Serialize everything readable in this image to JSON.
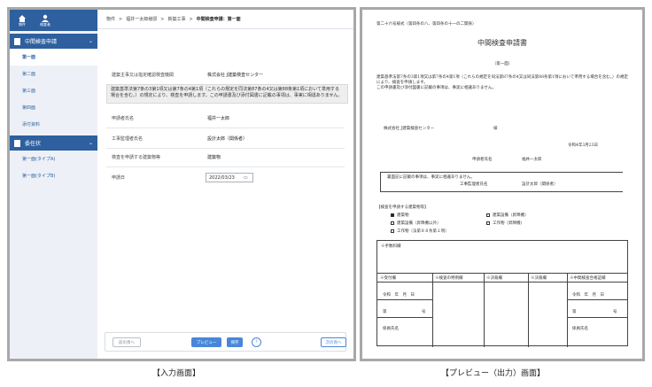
{
  "sidebar": {
    "nav": [
      {
        "label": "物件"
      },
      {
        "label": "検査者"
      }
    ],
    "group1": {
      "label": "中間検査申請"
    },
    "items": [
      {
        "label": "第一面",
        "active": true
      },
      {
        "label": "第二面"
      },
      {
        "label": "第三面"
      },
      {
        "label": "第四面"
      },
      {
        "label": "添付資料"
      }
    ],
    "group2": {
      "label": "委任状"
    },
    "items2": [
      {
        "label": "第一面(タイプA)"
      },
      {
        "label": "第一面(タイプB)"
      }
    ]
  },
  "breadcrumb": {
    "items": [
      "物件",
      "福井一太郎様邸",
      "新築工事"
    ],
    "current": "中間検査申請：第一面",
    "separator": ">"
  },
  "form": {
    "addressee_label": "建築主事又は指定確認検査機関",
    "addressee_value": "株式会社 J建築検査センター",
    "notice": "建築基準法第7条の3第1項又は第7条の4第1項（これらの規定を同法第87条の4又は第88条第1項において準用する場合を含む。）の規定により、検査を申請します。この申請書及び添付図書に記載の事項は、事実に相違ありません。",
    "fields": [
      {
        "label": "申請者氏名",
        "value": "福井一太郎"
      },
      {
        "label": "工事監理者氏名",
        "value": "設計太郎（関係者）"
      },
      {
        "label": "検査を申請する建築物等",
        "value": "建築物"
      }
    ],
    "date_label": "申請日",
    "date_value": "2022/03/23"
  },
  "footer": {
    "prev": "前の頁へ",
    "preview": "プレビュー",
    "save": "保存",
    "help": "?",
    "next": "次の頁へ"
  },
  "doc": {
    "header": "第二十六号様式（第四条の八、第四条の十一の二関係）",
    "title": "中間検査申請書",
    "page": "（第一面）",
    "body1": "建築基準法第7条の3第1項又は第7条の4第1項（これらの規定を同法第87条の4又は同法第88条第1項において準用する場合を含む。）の規定により、検査を申請します。",
    "body2": "この申請書及び添付図書に記載の事項は、事実に相違ありません。",
    "to": "株式会社 J建築検査センター",
    "honorific": "様",
    "date": "令和4年3月23日",
    "applicant_label": "申請者氏名",
    "applicant": "福井一太郎",
    "supervisor_note": "裏面記に記載の事項は、事実に相違ありません。",
    "supervisor_label": "工事監理者氏名",
    "supervisor": "設計太郎（関係者）",
    "check_title": "【検査を申請する建築物等】",
    "checks": [
      {
        "label": "建築物",
        "checked": true
      },
      {
        "label": "建築設備（昇降機）",
        "checked": false
      },
      {
        "label": "建築設備（昇降機以外）",
        "checked": false
      },
      {
        "label": "工作物（昇降機）",
        "checked": false
      },
      {
        "label": "工作物（法第８８条第１項）",
        "checked": false
      }
    ],
    "fee_label": "※手数料欄",
    "table_headers": [
      "※受付欄",
      "※検査の特例欄",
      "※決裁欄",
      "※決裁欄",
      "※中間検査合格証欄"
    ],
    "cell_date": "令和　年　月　日",
    "cell_dai": "第",
    "cell_go": "号",
    "cell_staff": "係員氏名"
  },
  "captions": {
    "input": "【入力画面】",
    "preview": "【プレビュー（出力）画面】"
  }
}
